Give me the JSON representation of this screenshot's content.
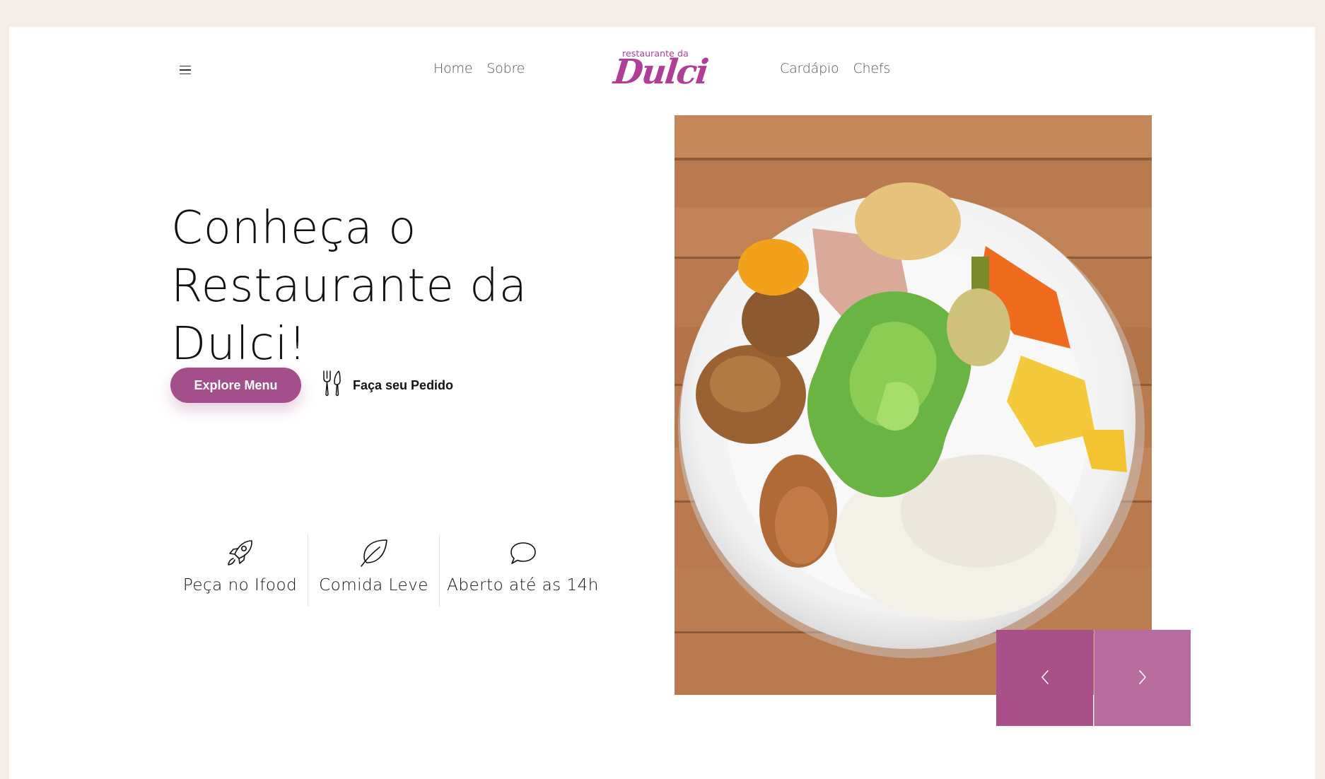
{
  "header": {
    "menu_icon": "hamburger-menu-icon",
    "nav_left": [
      "Home",
      "Sobre"
    ],
    "nav_right": [
      "Cardápio",
      "Chefs"
    ],
    "logo": {
      "top_text": "restaurante da",
      "main_text": "Dulci"
    }
  },
  "hero": {
    "title_line1": "Conheça o",
    "title_line2": "Restaurante da Dulci!",
    "explore_button": "Explore Menu",
    "order_link": "Faça seu Pedido",
    "order_icon": "fork-knife-icon"
  },
  "features": [
    {
      "icon": "rocket-icon",
      "label": "Peça no Ifood"
    },
    {
      "icon": "leaf-icon",
      "label": "Comida Leve"
    },
    {
      "icon": "chat-bubble-icon",
      "label": "Aberto até as 14h"
    }
  ],
  "slider": {
    "prev_icon": "chevron-left-icon",
    "next_icon": "chevron-right-icon"
  },
  "colors": {
    "page_background": "#f4ede8",
    "accent": "#a44f8c",
    "logo": "#b03d96",
    "slider_prev": "#a9508a",
    "slider_next": "#b86ca0"
  }
}
